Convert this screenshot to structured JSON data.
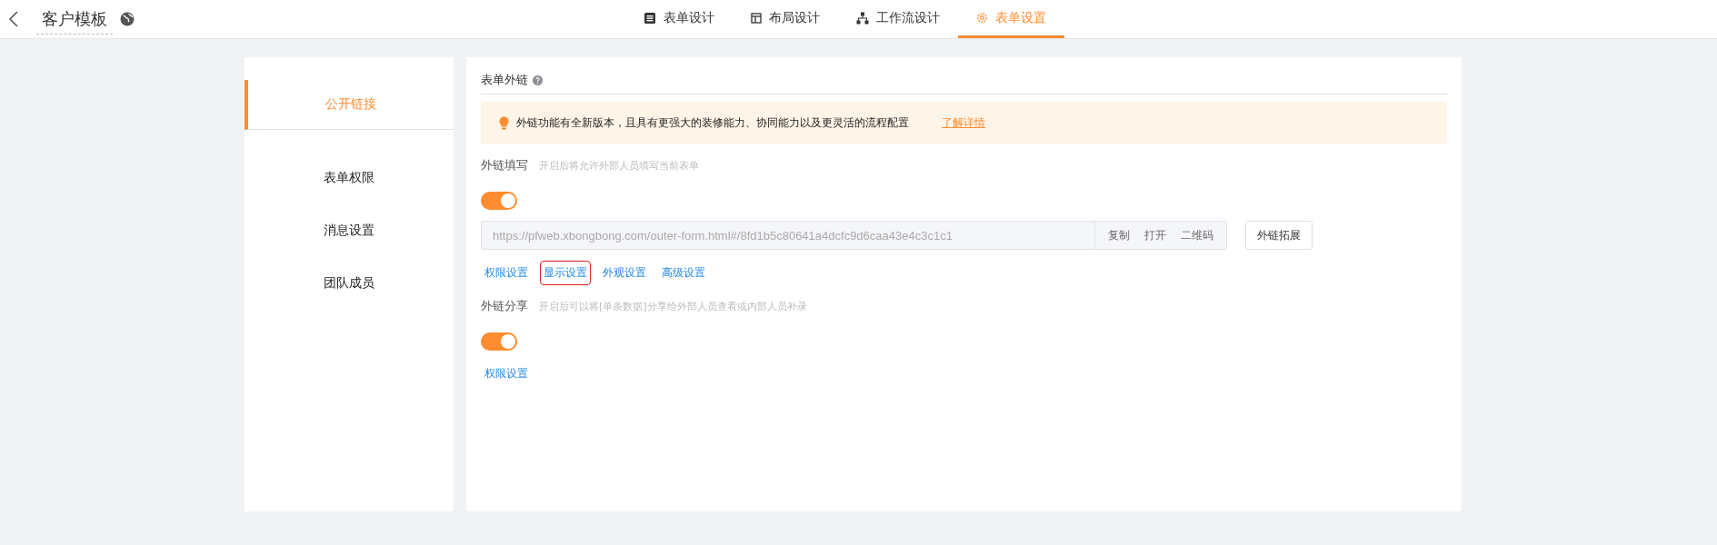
{
  "header": {
    "title": "客户模板"
  },
  "tabs": [
    {
      "label": "表单设计",
      "kind": "form",
      "selected": false
    },
    {
      "label": "布局设计",
      "kind": "layout",
      "selected": false
    },
    {
      "label": "工作流设计",
      "kind": "flow",
      "selected": false
    },
    {
      "label": "表单设置",
      "kind": "gear",
      "selected": true
    }
  ],
  "sidebar": {
    "items": [
      {
        "label": "公开链接",
        "selected": true
      },
      {
        "label": "表单权限",
        "selected": false
      },
      {
        "label": "消息设置",
        "selected": false
      },
      {
        "label": "团队成员",
        "selected": false
      }
    ]
  },
  "panel": {
    "title": "表单外链",
    "notice": {
      "text": "外链功能有全新版本，且具有更强大的装修能力、协同能力以及更灵活的流程配置",
      "link": "了解详情"
    },
    "sections": [
      {
        "label": "外链填写",
        "hint": "开启后将允许外部人员填写当前表单",
        "on": true,
        "url": {
          "value": "https://pfweb.xbongbong.com/outer-form.html#/8fd1b5c80641a4dcfc9d6caa43e4c3c1c1",
          "actions": [
            "复制",
            "打开",
            "二维码"
          ],
          "extra_button": "外链拓展"
        },
        "links": [
          {
            "label": "权限设置",
            "highlighted": false
          },
          {
            "label": "显示设置",
            "highlighted": true
          },
          {
            "label": "外观设置",
            "highlighted": false
          },
          {
            "label": "高级设置",
            "highlighted": false
          }
        ]
      },
      {
        "label": "外链分享",
        "hint": "开启后可以将[单条数据]分享给外部人员查看或内部人员补录",
        "on": true,
        "links": [
          {
            "label": "权限设置",
            "highlighted": false
          }
        ]
      }
    ]
  }
}
